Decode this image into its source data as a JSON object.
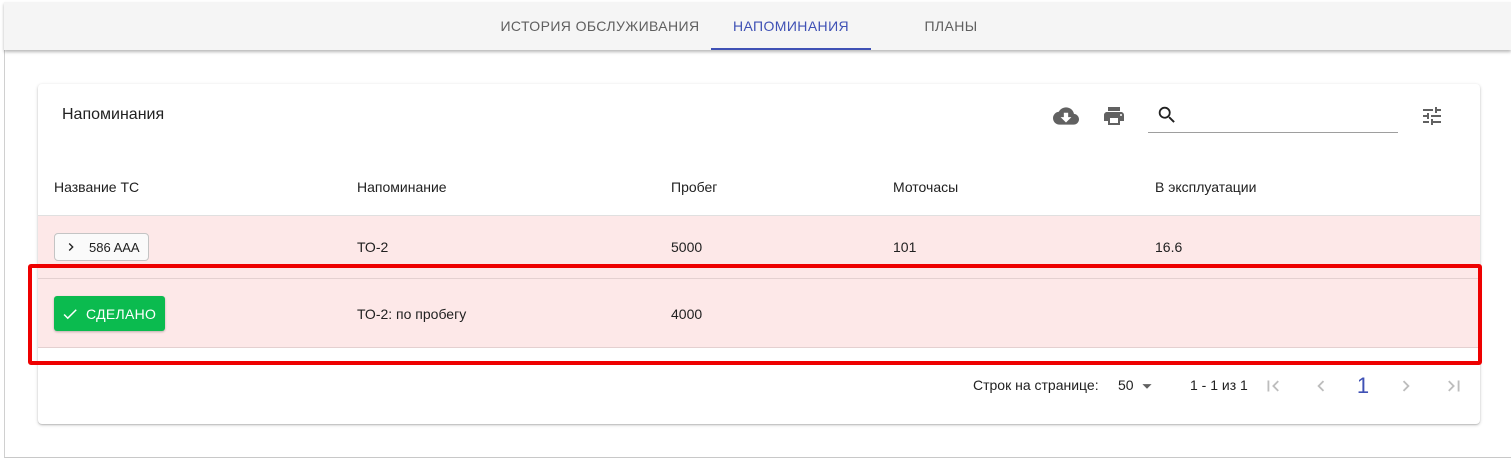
{
  "tabs": [
    {
      "label": "ИСТОРИЯ ОБСЛУЖИВАНИЯ",
      "active": false
    },
    {
      "label": "НАПОМИНАНИЯ",
      "active": true
    },
    {
      "label": "ПЛАНЫ",
      "active": false
    }
  ],
  "colors": {
    "accent": "#3f51b5",
    "row_bg": "#fde8e8",
    "done": "#0bbb4f",
    "highlight": "#ee0000"
  },
  "card": {
    "title": "Напоминания",
    "toolbar": {
      "download_icon": "cloud-download-icon",
      "print_icon": "print-icon",
      "search_icon": "search-icon",
      "filter_icon": "tune-icon",
      "search_value": ""
    }
  },
  "table": {
    "columns": [
      "Название ТС",
      "Напоминание",
      "Пробег",
      "Моточасы",
      "В эксплуатации"
    ],
    "group_row": {
      "vehicle": "586 AAA",
      "reminder": "ТО-2",
      "mileage": "5000",
      "motohours": "101",
      "in_service": "16.6"
    },
    "detail_row": {
      "action_label": "СДЕЛАНО",
      "reminder": "ТО-2: по пробегу",
      "mileage": "4000",
      "motohours": "",
      "in_service": ""
    }
  },
  "pagination": {
    "rows_per_page_label": "Строк на странице:",
    "rows_per_page": "50",
    "range": "1 - 1 из 1",
    "current_page": "1"
  }
}
